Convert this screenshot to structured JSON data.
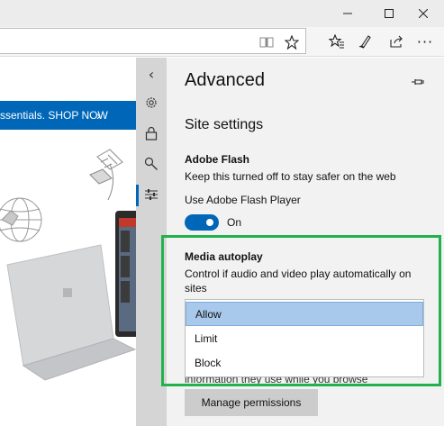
{
  "window": {
    "minimize_icon": "minimize-icon",
    "maximize_icon": "maximize-icon",
    "close_icon": "close-icon"
  },
  "toolbar": {
    "more_label": "···"
  },
  "webpage": {
    "promo_text": "ssentials. SHOP NOW",
    "promo_chevron": "›",
    "promo_color": "#0067b8"
  },
  "strip": {
    "back_label": "‹"
  },
  "panel": {
    "title": "Advanced",
    "section_title": "Site settings",
    "flash": {
      "title": "Adobe Flash",
      "description": "Keep this turned off to stay safer on the web",
      "use_label": "Use Adobe Flash Player",
      "toggle_state": "On"
    },
    "media": {
      "title": "Media autoplay",
      "description": "Control if audio and video play automatically on sites",
      "options": [
        "Allow",
        "Limit",
        "Block"
      ],
      "selected": "Allow"
    },
    "partial_text": "information they use while you browse",
    "manage_button": "Manage permissions"
  },
  "colors": {
    "accent": "#0067b8",
    "highlight_frame": "#22b24c",
    "panel_bg": "#f2f2f2",
    "selected_option_bg": "#a8c9ec"
  }
}
